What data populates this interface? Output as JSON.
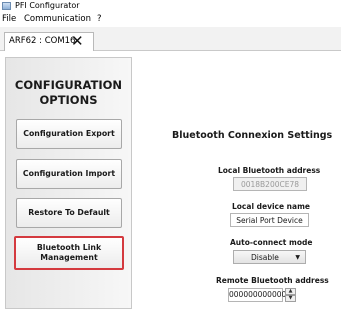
{
  "window": {
    "title": "PFI Configurator"
  },
  "menu": {
    "file": "File",
    "communication": "Communication",
    "help": "?"
  },
  "tab": {
    "label": "ARF62 : COM16",
    "close_glyph": "✕"
  },
  "sidebar": {
    "title_line1": "CONFIGURATION",
    "title_line2": "OPTIONS",
    "buttons": [
      {
        "label": "Configuration Export"
      },
      {
        "label": "Configuration Import"
      },
      {
        "label": "Restore To Default"
      },
      {
        "label_line1": "Bluetooth Link",
        "label_line2": "Management",
        "selected": true
      }
    ],
    "highlight_color": "#d43a3f"
  },
  "main": {
    "title": "Bluetooth Connexion Settings",
    "local_address": {
      "label": "Local Bluetooth address",
      "value": "0018B200CE78"
    },
    "device_name": {
      "label": "Local device name",
      "value": "Serial Port Device"
    },
    "auto_connect": {
      "label": "Auto-connect mode",
      "value": "Disable",
      "arrow": "▼"
    },
    "remote_address": {
      "label": "Remote Bluetooth address",
      "value": "000000000000",
      "up": "▲",
      "down": "▼"
    }
  }
}
